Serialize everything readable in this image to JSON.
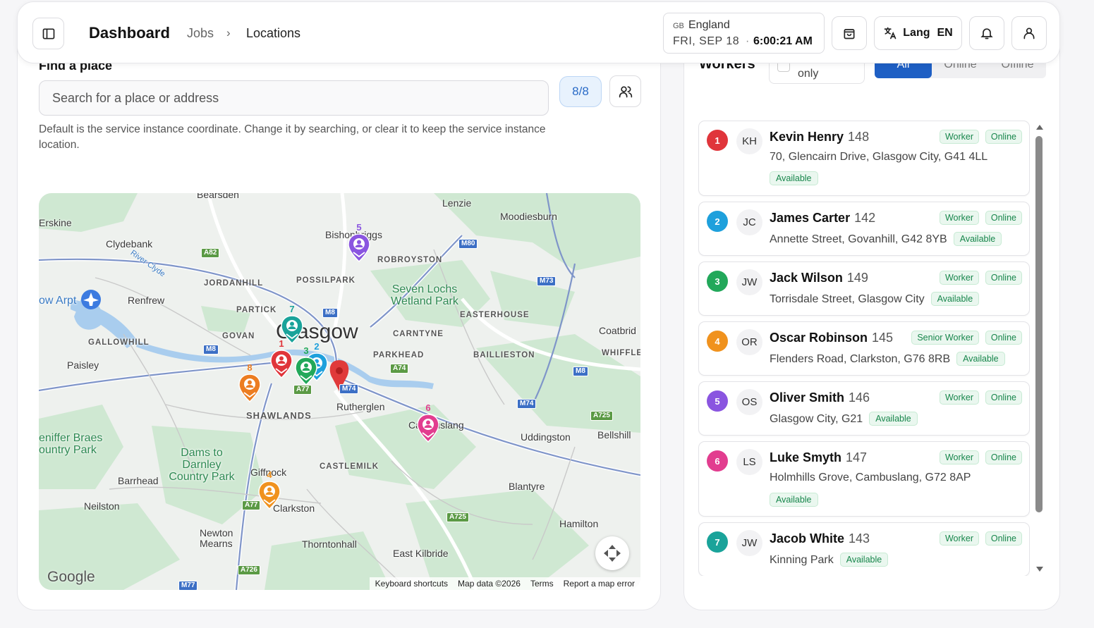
{
  "header": {
    "title": "Dashboard",
    "breadcrumb": {
      "jobs": "Jobs",
      "separator": "›",
      "current": "Locations"
    },
    "clock": {
      "country_code": "GB",
      "region": "England",
      "date": "FRI, SEP 18",
      "separator": "·",
      "time": "6:00:21 AM"
    },
    "lang": {
      "label": "Lang",
      "code": "EN"
    },
    "icons": [
      "sidebar-toggle-icon",
      "shopping-bag-icon",
      "translate-icon",
      "bell-icon",
      "user-icon"
    ]
  },
  "find_place": {
    "label": "Find a place",
    "placeholder": "Search for a place or address",
    "count": "8/8",
    "hint": "Default is the service instance coordinate. Change it by searching, or clear it to keep the service instance location."
  },
  "map": {
    "places": {
      "bearsden": "Bearsden",
      "lenzie": "Lenzie",
      "moodiesburn": "Moodiesburn",
      "erskine": "Erskine",
      "clydebank": "Clydebank",
      "bishopbriggs": "Bishopbriggs",
      "robroyston": "ROBROYSTON",
      "river_clyde": "River Clyde",
      "jordanhill": "JORDANHILL",
      "possilpark": "POSSILPARK",
      "seven_lochs": "Seven Lochs Wetland Park",
      "glasgow_airport": "ow Arpt",
      "renfrew": "Renfrew",
      "partick": "PARTICK",
      "easterhouse": "EASTERHOUSE",
      "glasgow": "Glasgow",
      "govan": "GOVAN",
      "carntyne": "CARNTYNE",
      "coatbridge": "Coatbrid",
      "gallowhill": "GALLOWHILL",
      "whifflet": "WHIFFLE",
      "paisley": "Paisley",
      "parkhead": "PARKHEAD",
      "baillieston": "BAILLIESTON",
      "shawlands": "SHAWLANDS",
      "rutherglen": "Rutherglen",
      "cambuslang": "Cambuslang",
      "uddingston": "Uddingston",
      "bellshill": "Bellshill",
      "braes": "eniffer Braes ountry Park",
      "dams": "Dams to Darnley Country Park",
      "giffnock": "Giffnock",
      "castlemilk": "CASTLEMILK",
      "barrhead": "Barrhead",
      "blantyre": "Blantyre",
      "neilston": "Neilston",
      "clarkston": "Clarkston",
      "hamilton": "Hamilton",
      "newton_mearns": "Newton Mearns",
      "thornton": "Thorntonhall",
      "east_kilbride": "East Kilbride"
    },
    "roads": [
      "A82",
      "M80",
      "M73",
      "M8",
      "M8",
      "A74",
      "M74",
      "A77",
      "M8",
      "M74",
      "A725",
      "A77",
      "A725",
      "A726",
      "M77"
    ],
    "pins": [
      {
        "num": "1",
        "color": "#e0353b"
      },
      {
        "num": "2",
        "color": "#1ea0dc"
      },
      {
        "num": "3",
        "color": "#22a85a"
      },
      {
        "num": "4",
        "color": "#f0921e"
      },
      {
        "num": "5",
        "color": "#8a55e0"
      },
      {
        "num": "6",
        "color": "#e23d8f"
      },
      {
        "num": "7",
        "color": "#1aa39a"
      },
      {
        "num": "8",
        "color": "#ec7d22"
      }
    ],
    "google": "Google",
    "attribution": {
      "shortcuts": "Keyboard shortcuts",
      "data": "Map data ©2026",
      "terms": "Terms",
      "report": "Report a map error"
    }
  },
  "workers_panel": {
    "title": "Workers",
    "only_label": "only",
    "segments": [
      "All",
      "Online",
      "Offline"
    ],
    "active_segment": "All",
    "workers": [
      {
        "num": "1",
        "color": "#e0353b",
        "initials": "KH",
        "name": "Kevin Henry",
        "id": "148",
        "role": "Worker",
        "status": "Online",
        "address": "70, Glencairn Drive, Glasgow City, G41 4LL",
        "availability": "Available"
      },
      {
        "num": "2",
        "color": "#1ea0dc",
        "initials": "JC",
        "name": "James Carter",
        "id": "142",
        "role": "Worker",
        "status": "Online",
        "address": "Annette Street, Govanhill, G42 8YB",
        "availability": "Available"
      },
      {
        "num": "3",
        "color": "#22a85a",
        "initials": "JW",
        "name": "Jack Wilson",
        "id": "149",
        "role": "Worker",
        "status": "Online",
        "address": "Torrisdale Street, Glasgow City",
        "availability": "Available"
      },
      {
        "num": "4",
        "color": "#f0921e",
        "initials": "OR",
        "name": "Oscar Robinson",
        "id": "145",
        "role": "Senior Worker",
        "status": "Online",
        "address": "Flenders Road, Clarkston, G76 8RB",
        "availability": "Available"
      },
      {
        "num": "5",
        "color": "#8a55e0",
        "initials": "OS",
        "name": "Oliver Smith",
        "id": "146",
        "role": "Worker",
        "status": "Online",
        "address": "Glasgow City, G21",
        "availability": "Available"
      },
      {
        "num": "6",
        "color": "#e23d8f",
        "initials": "LS",
        "name": "Luke Smyth",
        "id": "147",
        "role": "Worker",
        "status": "Online",
        "address": "Holmhills Grove, Cambuslang, G72 8AP",
        "availability": "Available"
      },
      {
        "num": "7",
        "color": "#1aa39a",
        "initials": "JW",
        "name": "Jacob White",
        "id": "143",
        "role": "Worker",
        "status": "Online",
        "address": "Kinning Park",
        "availability": "Available"
      }
    ]
  }
}
